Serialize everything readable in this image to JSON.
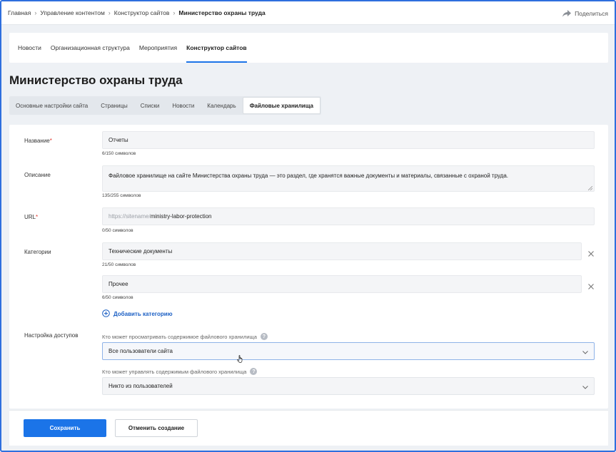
{
  "breadcrumb": {
    "items": [
      "Главная",
      "Управление контентом",
      "Конструктор сайтов"
    ],
    "current": "Министерство охраны труда"
  },
  "share": {
    "label": "Поделиться",
    "icon": "share-arrow-icon"
  },
  "nav": {
    "tabs": [
      "Новости",
      "Организационная структура",
      "Мероприятия",
      "Конструктор сайтов"
    ],
    "active_index": 3
  },
  "page_title": "Министерство охраны труда",
  "subtabs": {
    "items": [
      "Основные настройки сайта",
      "Страницы",
      "Списки",
      "Новости",
      "Календарь",
      "Файловые хранилища"
    ],
    "active_index": 5
  },
  "form": {
    "name": {
      "label": "Название",
      "required": "*",
      "value": "Отчеты",
      "counter": "6/150 символов"
    },
    "description": {
      "label": "Описание",
      "value": "Файловое хранилище на сайте Министерства охраны труда — это раздел, где хранятся важные документы и материалы, связанные с охраной труда.",
      "counter": "135/255 символов"
    },
    "url": {
      "label": "URL",
      "required": "*",
      "prefix": "https://sitename/",
      "value": "ministry-labor-protection",
      "counter": "0/50 символов"
    },
    "categories": {
      "label": "Категории",
      "items": [
        {
          "value": "Технические документы",
          "counter": "21/50 символов"
        },
        {
          "value": "Прочее",
          "counter": "6/50 символов"
        }
      ],
      "add_label": "Добавить категорию"
    },
    "access": {
      "label": "Настройка доступов",
      "view_question": "Кто может просматривать содержимое файлового хранилища",
      "view_value": "Все пользователи сайта",
      "manage_question": "Кто может управлять содержимым файлового хранилища",
      "manage_value": "Никто из пользователей",
      "help_glyph": "?"
    }
  },
  "footer": {
    "save_label": "Сохранить",
    "cancel_label": "Отменить создание"
  },
  "colors": {
    "accent": "#1b74e8",
    "required": "#e0382e",
    "link": "#1b5fc4",
    "frame": "#2e6fde"
  }
}
